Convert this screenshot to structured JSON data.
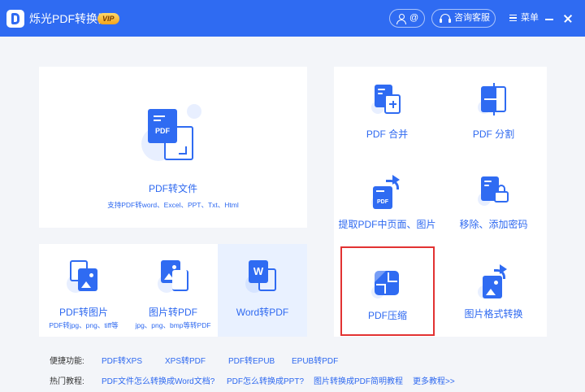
{
  "app": {
    "title": "烁光PDF转换器",
    "vip_label": "VIP",
    "user_label": "@",
    "service_label": "咨询客服",
    "menu_label": "菜单"
  },
  "main_card": {
    "label": "PDF转文件",
    "subtitle": "支持PDF转word、Excel、PPT、Txt、Html",
    "icon_text": "PDF"
  },
  "small_cards": [
    {
      "label": "PDF转图片",
      "subtitle": "PDF转jpg、png、tiff等"
    },
    {
      "label": "图片转PDF",
      "subtitle": "jpg、png、bmp等转PDF"
    },
    {
      "label": "Word转PDF",
      "subtitle": "",
      "icon_text": "W"
    }
  ],
  "tools": [
    {
      "label": "PDF 合并"
    },
    {
      "label": "PDF 分割"
    },
    {
      "label": "提取PDF中页面、图片",
      "icon_text": "PDF"
    },
    {
      "label": "移除、添加密码"
    },
    {
      "label": "PDF压缩"
    },
    {
      "label": "图片格式转换"
    }
  ],
  "quick_links": {
    "label": "便捷功能:",
    "items": [
      "PDF转XPS",
      "XPS转PDF",
      "PDF转EPUB",
      "EPUB转PDF"
    ]
  },
  "tutorials": {
    "label": "热门教程:",
    "items": [
      "PDF文件怎么转换成Word文档?",
      "PDF怎么转换成PPT?",
      "图片转换成PDF简明教程",
      "更多教程>>"
    ]
  },
  "colors": {
    "accent": "#2f6bf2",
    "highlight_border": "#e23232",
    "background": "#f3f5f9"
  }
}
